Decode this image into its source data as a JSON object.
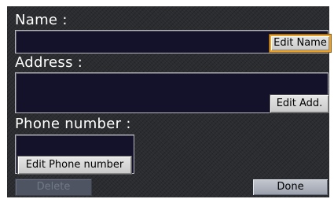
{
  "name_section": {
    "label": "Name :",
    "value": "",
    "edit_button": "Edit Name"
  },
  "address_section": {
    "label": "Address :",
    "value": "",
    "edit_button": "Edit Add."
  },
  "phone_section": {
    "label": "Phone number :",
    "value": "",
    "edit_button": "Edit Phone number"
  },
  "footer": {
    "delete_button": "Delete",
    "done_button": "Done"
  },
  "colors": {
    "highlight": "#e8a12a",
    "field_background": "#13122a",
    "screen_background": "#2b2c2f"
  }
}
